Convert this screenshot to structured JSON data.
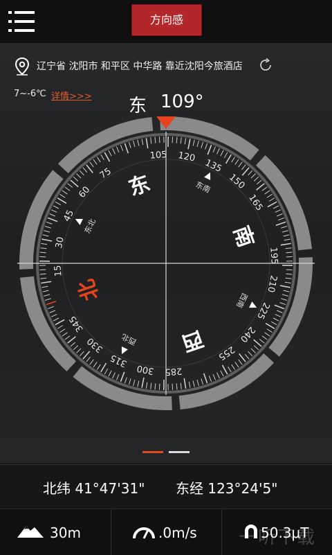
{
  "header": {
    "mode_button_label": "方向感",
    "menu_icon": "menu-icon"
  },
  "location": {
    "address": "辽宁省 沈阳市 和平区 中华路 靠近沈阳今旅酒店",
    "pin_icon": "location-pin-icon",
    "refresh_icon": "refresh-icon"
  },
  "weather": {
    "temperature": "7~-6℃",
    "detail_link": "详情>>>"
  },
  "heading": {
    "direction": "东",
    "degrees": "109°",
    "value": 109
  },
  "compass": {
    "cardinals": {
      "east": "东",
      "south": "南",
      "west": "西",
      "north": "北"
    },
    "intercardinals": {
      "northeast": "东北",
      "southeast": "东南",
      "southwest": "西南",
      "northwest": "西北"
    },
    "tick_labels": [
      "105",
      "120",
      "135",
      "150",
      "165",
      "195",
      "210",
      "225",
      "240",
      "255",
      "285",
      "300",
      "315",
      "330",
      "345",
      "15",
      "30",
      "45",
      "60",
      "75"
    ],
    "accent_color": "#e8431f",
    "ring_color": "#8a8a8a"
  },
  "position": {
    "latitude": "北纬 41°47'31\"",
    "longitude": "东经 123°24'5\""
  },
  "stats": {
    "altitude": "30m",
    "speed": ".0m/s",
    "magnetic": "50.3μT",
    "altitude_icon": "mountain-icon",
    "speed_icon": "speedometer-icon",
    "magnetic_icon": "magnet-icon"
  },
  "watermark": {
    "text": "一听下载"
  }
}
